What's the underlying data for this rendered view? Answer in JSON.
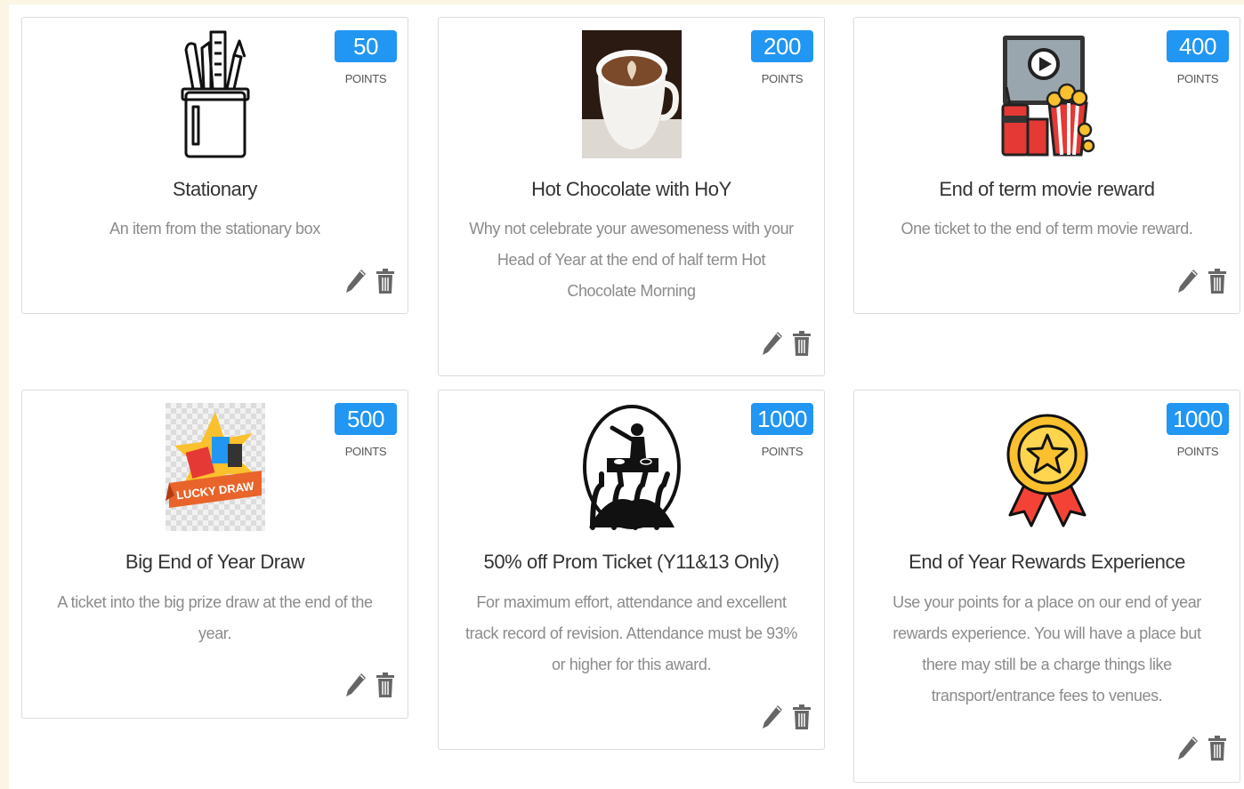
{
  "rewards": [
    {
      "points": "50",
      "points_label": "POINTS",
      "title": "Stationary",
      "description": "An item from the stationary box",
      "image": "pencil-cup-icon"
    },
    {
      "points": "200",
      "points_label": "POINTS",
      "title": "Hot Chocolate with HoY",
      "description": "Why not celebrate your awesomeness with your Head of Year at the end of half term Hot Chocolate Morning",
      "image": "hot-chocolate-photo"
    },
    {
      "points": "400",
      "points_label": "POINTS",
      "title": "End of term movie reward",
      "description": "One ticket to the end of term movie reward.",
      "image": "movie-popcorn-icon"
    },
    {
      "points": "500",
      "points_label": "POINTS",
      "title": "Big End of Year Draw",
      "description": "A ticket into the big prize draw at the end of the year.",
      "image": "lucky-draw-icon",
      "image_text": "LUCKY DRAW"
    },
    {
      "points": "1000",
      "points_label": "POINTS",
      "title": "50% off Prom Ticket (Y11&13 Only)",
      "description": "For maximum effort, attendance and excellent track record of revision. Attendance must be 93% or higher for this award.",
      "image": "dj-crowd-icon"
    },
    {
      "points": "1000",
      "points_label": "POINTS",
      "title": "End of Year Rewards Experience",
      "description": "Use your points for a place on our end of year rewards experience. You will have a place but there may still be a charge things like transport/entrance fees to venues.",
      "image": "award-medal-icon"
    }
  ],
  "colors": {
    "badge": "#2196f3",
    "title": "#333333",
    "description": "#8b8b8b",
    "icon": "#666666"
  }
}
